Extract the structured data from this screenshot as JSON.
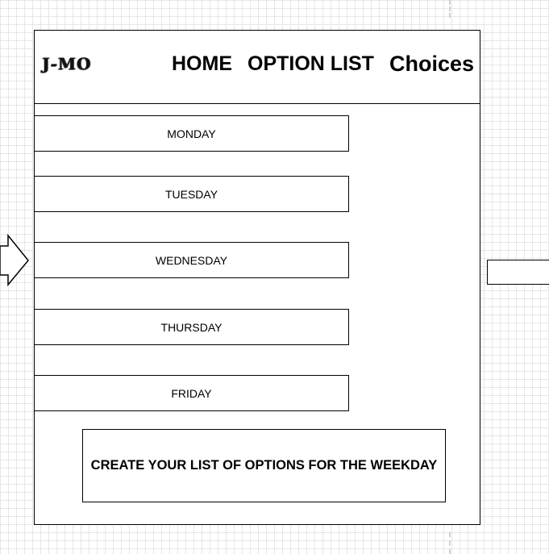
{
  "logo": {
    "text": "J-MO"
  },
  "nav": {
    "home": "HOME",
    "option_list": "OPTION LIST",
    "choices": "Choices"
  },
  "days": [
    "MONDAY",
    "TUESDAY",
    "WEDNESDAY",
    "THURSDAY",
    "FRIDAY"
  ],
  "create_button": "CREATE YOUR LIST OF OPTIONS FOR THE WEEKDAY"
}
